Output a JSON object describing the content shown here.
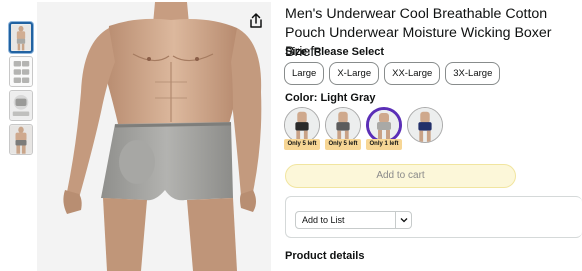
{
  "product": {
    "title": "Men's Underwear Cool Breathable Cotton Pouch Underwear Moisture Wicking Boxer Briefs"
  },
  "size": {
    "label": "Size:",
    "selection": "Please Select",
    "options": [
      "Large",
      "X-Large",
      "XX-Large",
      "3X-Large"
    ]
  },
  "color": {
    "label": "Color:",
    "selection": "Light Gray",
    "swatches": [
      {
        "name": "black",
        "trunk": "#2a2a2a",
        "stock": "Only 5 left"
      },
      {
        "name": "dark-gray",
        "trunk": "#5c5c5c",
        "stock": "Only 5 left"
      },
      {
        "name": "light-gray",
        "trunk": "#a9a9a6",
        "stock": "Only 1 left"
      },
      {
        "name": "navy",
        "trunk": "#23306a",
        "stock": ""
      }
    ]
  },
  "actions": {
    "add_to_cart": "Add to cart",
    "add_to_list": "Add to List"
  },
  "sections": {
    "details": "Product details"
  },
  "icons": {
    "share": "share-icon",
    "dropdown": "chevron-down-icon"
  },
  "colors": {
    "selected_swatch_border": "#5b2fb7",
    "stock_badge": "#f7d695",
    "cart_button_bg": "#fcf7d9",
    "thumb_selected_border": "#2162a1"
  }
}
